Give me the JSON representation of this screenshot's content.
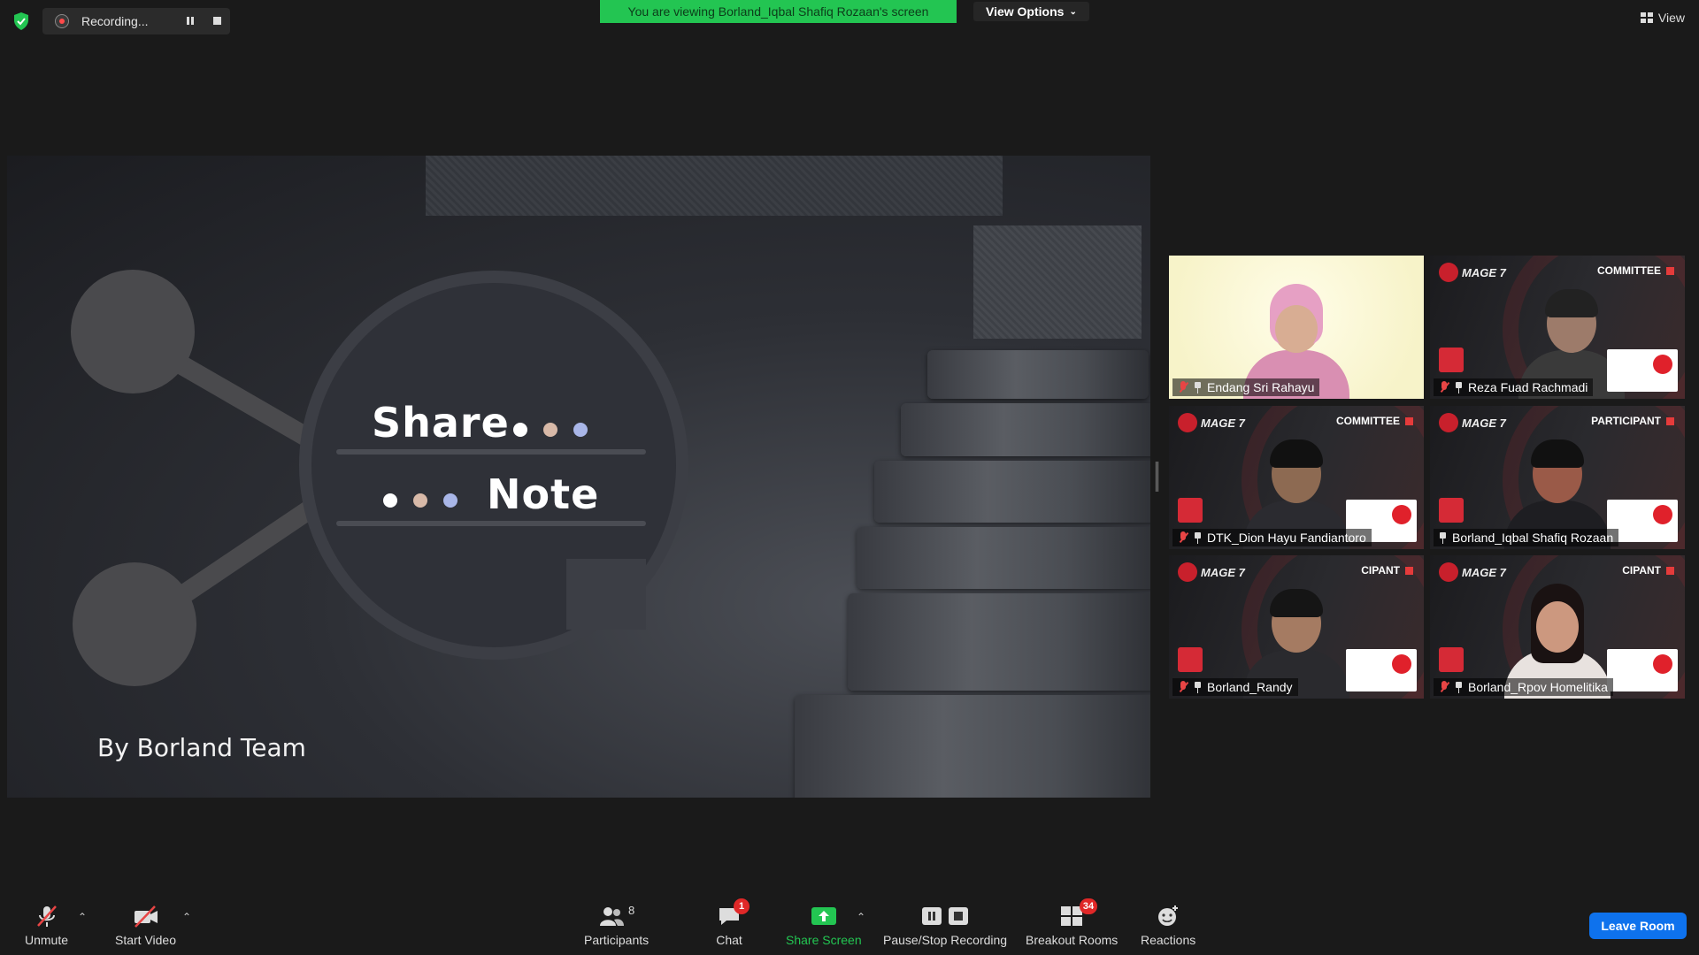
{
  "top_bar": {
    "recording_label": "Recording...",
    "viewing_banner": "You are viewing Borland_Iqbal Shafiq Rozaan's screen",
    "view_options_label": "View Options",
    "view_label": "View"
  },
  "shared_screen": {
    "share_word": "Share",
    "note_word": "Note",
    "byline": "By Borland Team",
    "dot_colors": [
      "#ffffff",
      "#d8b9a8",
      "#a9b6e8"
    ]
  },
  "gallery": {
    "tiles": [
      {
        "name": "Endang Sri Rahayu",
        "role": "",
        "active": false,
        "theme": "light"
      },
      {
        "name": "Reza Fuad Rachmadi",
        "role": "COMMITTEE",
        "active": false,
        "theme": "dark"
      },
      {
        "name": "DTK_Dion Hayu Fandiantoro",
        "role": "COMMITTEE",
        "active": false,
        "theme": "dark"
      },
      {
        "name": "Borland_Iqbal Shafiq Rozaan",
        "role": "PARTICIPANT",
        "active": true,
        "theme": "dark"
      },
      {
        "name": "Borland_Randy",
        "role": "CIPANT",
        "active": false,
        "theme": "dark"
      },
      {
        "name": "Borland_Rpov Homelitika",
        "role": "CIPANT",
        "active": false,
        "theme": "dark"
      }
    ],
    "brand_text": "MAGE 7"
  },
  "toolbar": {
    "unmute": "Unmute",
    "start_video": "Start Video",
    "participants": "Participants",
    "participants_count": "8",
    "chat": "Chat",
    "chat_badge": "1",
    "share_screen": "Share Screen",
    "pause_stop_recording": "Pause/Stop Recording",
    "breakout_rooms": "Breakout Rooms",
    "breakout_badge": "34",
    "reactions": "Reactions",
    "leave_room": "Leave Room"
  },
  "colors": {
    "banner_green": "#23c552",
    "share_green": "#23c552",
    "leave_blue": "#0e72ed",
    "active_outline": "#b9e04a"
  }
}
